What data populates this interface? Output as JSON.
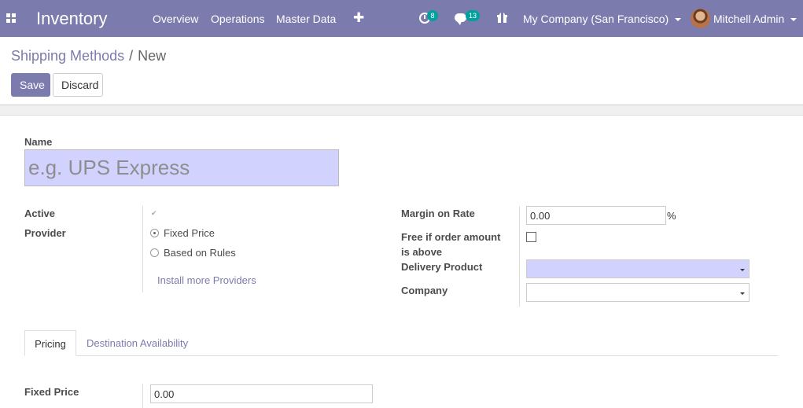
{
  "navbar": {
    "app_name": "Inventory",
    "menu": [
      "Overview",
      "Operations",
      "Master Data"
    ],
    "activity_count": "8",
    "messages_count": "13",
    "company": "My Company (San Francisco)",
    "user": "Mitchell Admin",
    "accent_color": "#7c7bad"
  },
  "breadcrumb": {
    "parent": "Shipping Methods",
    "separator": "/",
    "current": "New"
  },
  "buttons": {
    "save": "Save",
    "discard": "Discard"
  },
  "form": {
    "name_label": "Name",
    "name_placeholder": "e.g. UPS Express",
    "active_label": "Active",
    "provider_label": "Provider",
    "provider_options": [
      "Fixed Price",
      "Based on Rules"
    ],
    "provider_selected": "Fixed Price",
    "install_link": "Install more Providers",
    "margin_label": "Margin on Rate",
    "margin_value": "0.00",
    "margin_unit": "%",
    "free_label_line1": "Free if order amount",
    "free_label_line2": "is above",
    "delivery_product_label": "Delivery Product",
    "company_label": "Company"
  },
  "tabs": [
    "Pricing",
    "Destination Availability"
  ],
  "pricing": {
    "fixed_price_label": "Fixed Price",
    "fixed_price_value": "0.00"
  }
}
